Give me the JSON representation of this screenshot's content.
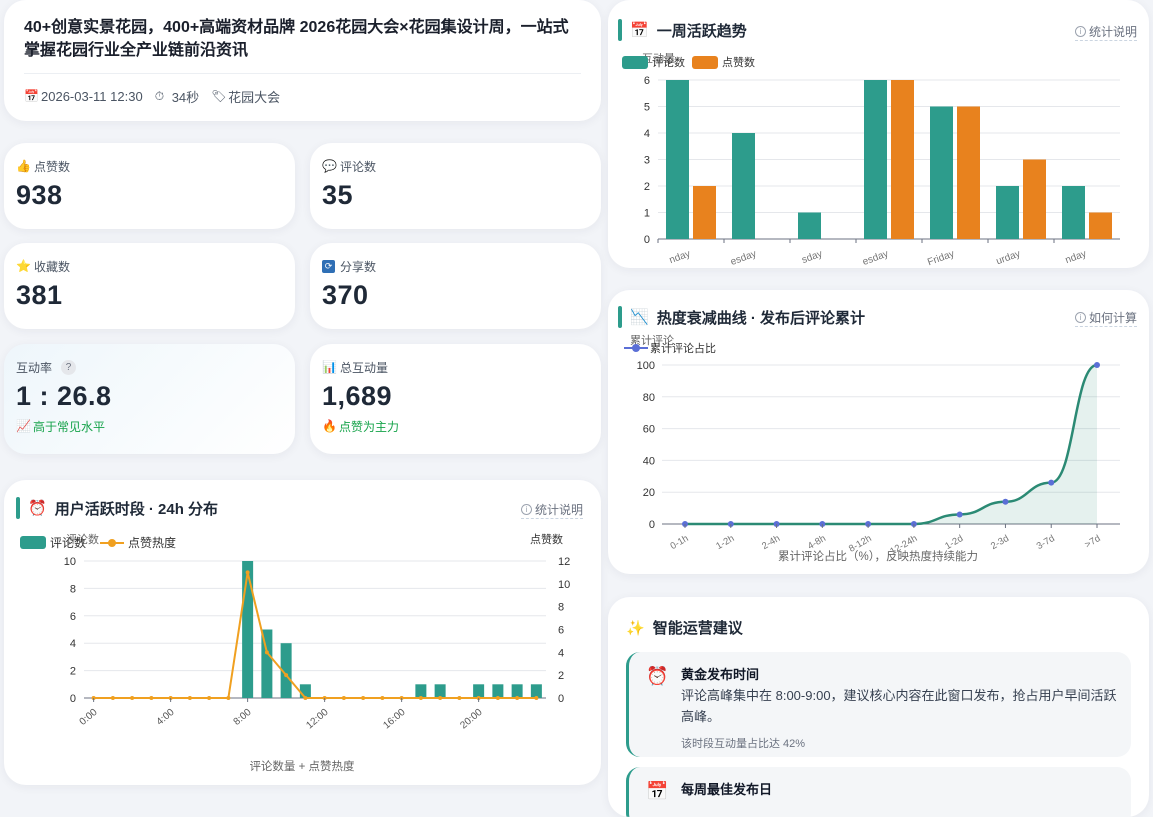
{
  "post": {
    "title": "40+创意实景花园，400+高端资材品牌 2026花园大会×花园集设计周，一站式掌握花园行业全产业链前沿资讯",
    "date": "2026-03-11 12:30",
    "duration": "34秒",
    "tag": "花园大会"
  },
  "stats": {
    "likes": {
      "label": "点赞数",
      "value": "938",
      "icon": "thumbs-up-icon"
    },
    "comments": {
      "label": "评论数",
      "value": "35",
      "icon": "speech-bubble-icon"
    },
    "favorites": {
      "label": "收藏数",
      "value": "381",
      "icon": "star-icon"
    },
    "shares": {
      "label": "分享数",
      "value": "370",
      "icon": "share-icon"
    },
    "rate": {
      "label": "互动率",
      "help": "?",
      "value": "1 : 26.8",
      "sub": "高于常见水平",
      "sub_icon": "chart-up-icon"
    },
    "total": {
      "label": "总互动量",
      "value": "1,689",
      "sub": "点赞为主力",
      "sub_icon": "fire-icon"
    }
  },
  "weekly": {
    "title": "一周活跃趋势",
    "help": "统计说明",
    "legend": [
      "评论数",
      "点赞数"
    ],
    "y_axis_name": "互动量",
    "colors": {
      "comments": "#2d9c8c",
      "likes": "#e8821e"
    }
  },
  "decay": {
    "title": "热度衰减曲线 · 发布后评论累计",
    "help": "如何计算",
    "legend": "累计评论占比",
    "y_axis_name": "累计评论",
    "caption": "累计评论占比（%），反映热度持续能力",
    "color": "#2b8a74"
  },
  "hourly": {
    "title": "用户活跃时段 · 24h 分布",
    "help": "统计说明",
    "legend": [
      "评论数",
      "点赞热度"
    ],
    "y_left_name": "评论数",
    "y_right_name": "点赞数",
    "caption": "评论数量 + 点赞热度",
    "colors": {
      "comments": "#2d9c8c",
      "likes": "#f0a020"
    }
  },
  "advice": {
    "title": "智能运营建议",
    "items": [
      {
        "icon": "alarm-clock-icon",
        "heading": "黄金发布时间",
        "body": "评论高峰集中在 8:00-9:00，建议核心内容在此窗口发布，抢占用户早间活跃高峰。",
        "note": "该时段互动量占比达 42%"
      },
      {
        "icon": "calendar-icon",
        "heading": "每周最佳发布日",
        "body": "",
        "note": ""
      }
    ]
  },
  "chart_data": [
    {
      "type": "bar",
      "title": "一周活跃趋势",
      "categories": [
        "Sunday",
        "Monday",
        "Tuesday",
        "Wednesday",
        "Friday",
        "Saturday",
        "Sunday"
      ],
      "category_labels_visible": [
        "nday",
        "esday",
        "sday",
        "esday",
        "Friday",
        "urday",
        "nday"
      ],
      "ylabel": "互动量",
      "ylim": [
        0,
        6
      ],
      "yticks": [
        0,
        1,
        2,
        3,
        4,
        5,
        6
      ],
      "series": [
        {
          "name": "评论数",
          "values": [
            6,
            4,
            1,
            6,
            5,
            2,
            2
          ]
        },
        {
          "name": "点赞数",
          "values": [
            2,
            0,
            0,
            6,
            5,
            3,
            1
          ]
        }
      ],
      "legend": "top-left",
      "grid": true
    },
    {
      "type": "area",
      "title": "热度衰减曲线 · 发布后评论累计",
      "categories": [
        "0-1h",
        "1-2h",
        "2-4h",
        "4-8h",
        "8-12h",
        "12-24h",
        "1-2d",
        "2-3d",
        "3-7d",
        ">7d"
      ],
      "ylabel": "累计评论",
      "xlabel": "累计评论占比（%），反映热度持续能力",
      "ylim": [
        0,
        100
      ],
      "yticks": [
        0,
        20,
        40,
        60,
        80,
        100
      ],
      "series": [
        {
          "name": "累计评论占比",
          "values": [
            0,
            0,
            0,
            0,
            0,
            0,
            6,
            14,
            26,
            100
          ]
        }
      ],
      "legend": "top-left",
      "grid": true
    },
    {
      "type": "bar",
      "title": "用户活跃时段 · 24h 分布",
      "xlabel": "评论数量 + 点赞热度",
      "categories": [
        "0:00",
        "1:00",
        "2:00",
        "3:00",
        "4:00",
        "5:00",
        "6:00",
        "7:00",
        "8:00",
        "9:00",
        "10:00",
        "11:00",
        "12:00",
        "13:00",
        "14:00",
        "15:00",
        "16:00",
        "17:00",
        "18:00",
        "19:00",
        "20:00",
        "21:00",
        "22:00",
        "23:00"
      ],
      "xticks": [
        "0:00",
        "4:00",
        "8:00",
        "12:00",
        "16:00",
        "20:00"
      ],
      "series": [
        {
          "name": "评论数",
          "type": "bar",
          "axis": "left",
          "values": [
            0,
            0,
            0,
            0,
            0,
            0,
            0,
            0,
            10,
            5,
            4,
            1,
            0,
            0,
            0,
            0,
            0,
            1,
            1,
            0,
            1,
            1,
            1,
            1
          ]
        },
        {
          "name": "点赞热度",
          "type": "line",
          "axis": "right",
          "values": [
            0,
            0,
            0,
            0,
            0,
            0,
            0,
            0,
            11,
            4,
            2,
            0,
            0,
            0,
            0,
            0,
            0,
            0,
            0,
            0,
            0,
            0,
            0,
            0
          ]
        }
      ],
      "ylim_left": [
        0,
        10
      ],
      "yticks_left": [
        0,
        2,
        4,
        6,
        8,
        10
      ],
      "ylim_right": [
        0,
        12
      ],
      "yticks_right": [
        0,
        2,
        4,
        6,
        8,
        10,
        12
      ],
      "legend": "top-left",
      "grid": true
    }
  ]
}
